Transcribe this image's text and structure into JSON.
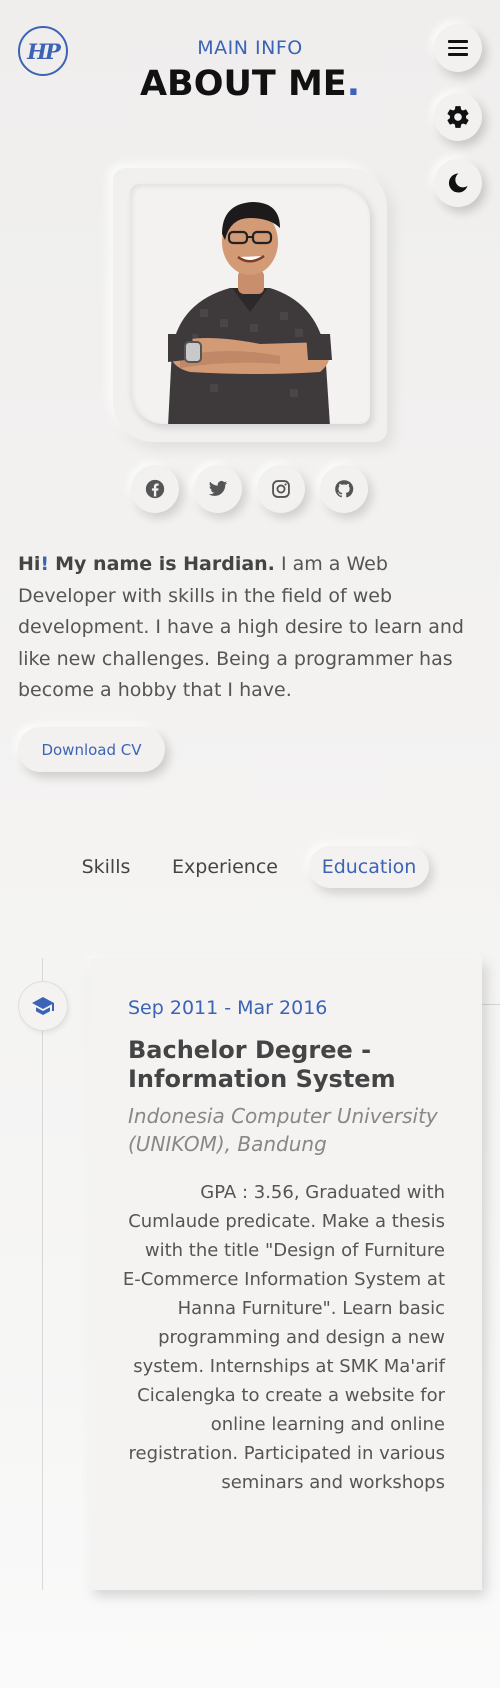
{
  "logo": {
    "text": "HP"
  },
  "header": {
    "subtitle": "MAIN INFO",
    "title": "ABOUT ME",
    "title_dot": "."
  },
  "controls": {
    "menu_icon": "hamburger-icon",
    "settings_icon": "gear-icon",
    "theme_icon": "moon-icon"
  },
  "social": [
    {
      "name": "facebook",
      "icon": "facebook-icon"
    },
    {
      "name": "twitter",
      "icon": "twitter-icon"
    },
    {
      "name": "instagram",
      "icon": "instagram-icon"
    },
    {
      "name": "github",
      "icon": "github-icon"
    }
  ],
  "bio": {
    "greeting": "Hi",
    "exclamation": "!",
    "name_intro": "My name is Hardian.",
    "text": "I am a Web Developer with skills in the field of web development. I have a high desire to learn and like new challenges. Being a programmer has become a hobby that I have."
  },
  "download_label": "Download CV",
  "tabs": [
    {
      "label": "Skills",
      "active": false
    },
    {
      "label": "Experience",
      "active": false
    },
    {
      "label": "Education",
      "active": true
    }
  ],
  "education": [
    {
      "icon": "graduation-cap-icon",
      "date": "Sep 2011 - Mar 2016",
      "degree": "Bachelor Degree - Information System",
      "school": "Indonesia Computer University (UNIKOM), Bandung",
      "description": "GPA : 3.56, Graduated with Cumlaude predicate. Make a thesis with the title \"Design of Furniture E-Commerce Information System at Hanna Furniture\". Learn basic programming and design a new system. Internships at SMK Ma'arif Cicalengka to create a website for online learning and online registration. Participated in various seminars and workshops"
    }
  ],
  "colors": {
    "accent": "#3d63b6",
    "text": "#555555",
    "heading": "#111111",
    "background": "#efeeed"
  }
}
